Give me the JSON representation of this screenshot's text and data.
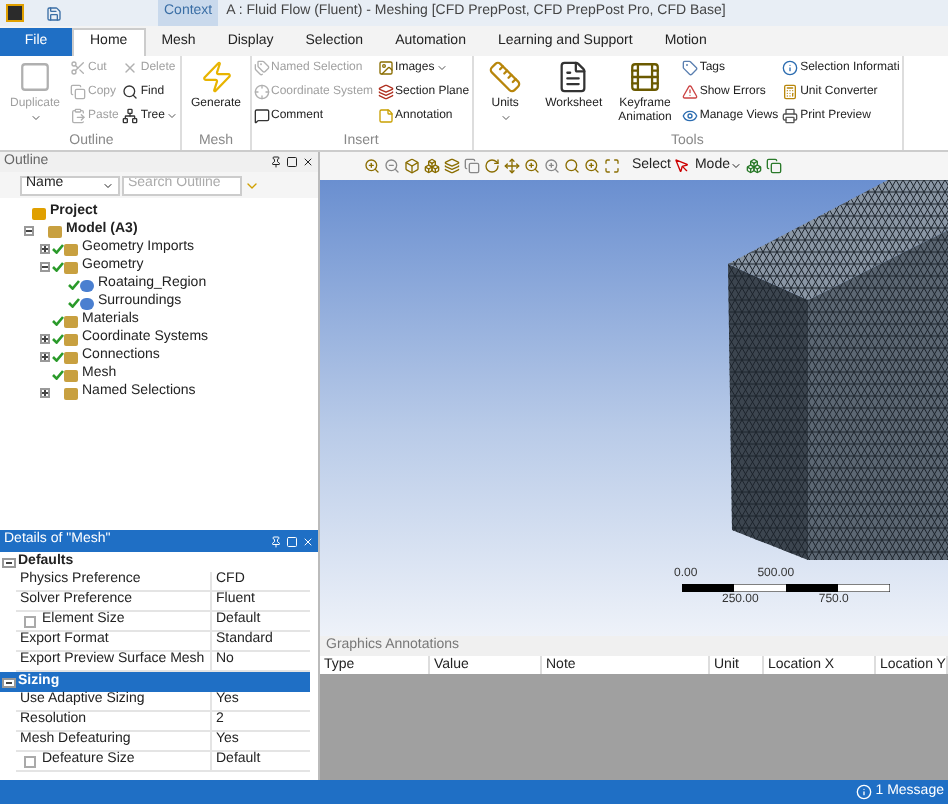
{
  "title_bar": {
    "context_tab": "Context",
    "title": "A : Fluid Flow (Fluent) - Meshing [CFD PrepPost, CFD PrepPost Pro, CFD Base]"
  },
  "ribbon_tabs": [
    {
      "label": "File",
      "kind": "file",
      "selected": false
    },
    {
      "label": "Home",
      "kind": "tab",
      "selected": true
    },
    {
      "label": "Mesh",
      "kind": "tab",
      "selected": false
    },
    {
      "label": "Display",
      "kind": "tab",
      "selected": false
    },
    {
      "label": "Selection",
      "kind": "tab",
      "selected": false
    },
    {
      "label": "Automation",
      "kind": "tab",
      "selected": false
    },
    {
      "label": "Learning and Support",
      "kind": "tab",
      "selected": false
    },
    {
      "label": "Motion",
      "kind": "tab",
      "selected": false
    }
  ],
  "ribbon_groups": [
    {
      "label": "Outline",
      "columns": [
        [
          {
            "label": "Duplicate",
            "kind": "large",
            "disabled": true,
            "dropdown": true
          }
        ],
        [
          {
            "label": "Cut",
            "kind": "small",
            "disabled": true,
            "dropdown": false
          },
          {
            "label": "Copy",
            "kind": "small",
            "disabled": true,
            "dropdown": false
          },
          {
            "label": "Paste",
            "kind": "small",
            "disabled": true,
            "dropdown": false
          }
        ],
        [
          {
            "label": "Delete",
            "kind": "small",
            "disabled": true,
            "dropdown": false
          },
          {
            "label": "Find",
            "kind": "small",
            "disabled": false,
            "dropdown": false
          },
          {
            "label": "Tree",
            "kind": "small",
            "disabled": false,
            "dropdown": true
          }
        ]
      ]
    },
    {
      "label": "Mesh",
      "columns": [
        [
          {
            "label": "Generate",
            "kind": "large",
            "disabled": false,
            "dropdown": false
          }
        ]
      ]
    },
    {
      "label": "Insert",
      "columns": [
        [
          {
            "label": "Named Selection",
            "kind": "small",
            "disabled": true,
            "dropdown": false
          },
          {
            "label": "Coordinate System",
            "kind": "small",
            "disabled": true,
            "dropdown": false
          },
          {
            "label": "Comment",
            "kind": "small",
            "disabled": false,
            "dropdown": false
          }
        ],
        [
          {
            "label": "Images",
            "kind": "small",
            "disabled": false,
            "dropdown": true
          },
          {
            "label": "Section Plane",
            "kind": "small",
            "disabled": false,
            "dropdown": false
          },
          {
            "label": "Annotation",
            "kind": "small",
            "disabled": false,
            "dropdown": false
          }
        ]
      ]
    },
    {
      "label": "Tools",
      "columns": [
        [
          {
            "label": "Units",
            "kind": "large",
            "disabled": false,
            "dropdown": true
          }
        ],
        [
          {
            "label": "Worksheet",
            "kind": "large",
            "disabled": false,
            "dropdown": false
          }
        ],
        [
          {
            "label": "Keyframe Animation",
            "kind": "large",
            "disabled": false,
            "dropdown": false
          }
        ],
        [
          {
            "label": "Tags",
            "kind": "small",
            "disabled": false,
            "dropdown": false
          },
          {
            "label": "Show Errors",
            "kind": "small",
            "disabled": false,
            "dropdown": false
          },
          {
            "label": "Manage Views",
            "kind": "small",
            "disabled": false,
            "dropdown": false
          }
        ],
        [
          {
            "label": "Selection Informati",
            "kind": "small",
            "disabled": false,
            "dropdown": false
          },
          {
            "label": "Unit Converter",
            "kind": "small",
            "disabled": false,
            "dropdown": false
          },
          {
            "label": "Print Preview",
            "kind": "small",
            "disabled": false,
            "dropdown": false
          }
        ]
      ]
    }
  ],
  "outline": {
    "title": "Outline",
    "filter": "Name",
    "search_placeholder": "Search Outline",
    "tree": [
      {
        "label": "Project",
        "ok": false,
        "children": [
          {
            "label": "Model (A3)",
            "ok": false,
            "expanded": true,
            "children": [
              {
                "label": "Geometry Imports",
                "ok": true,
                "expanded": false
              },
              {
                "label": "Geometry",
                "ok": true,
                "expanded": true,
                "children": [
                  {
                    "label": "Roataing_Region",
                    "ok": true
                  },
                  {
                    "label": "Surroundings",
                    "ok": true
                  }
                ]
              },
              {
                "label": "Materials",
                "ok": true
              },
              {
                "label": "Coordinate Systems",
                "ok": true,
                "expanded": false
              },
              {
                "label": "Connections",
                "ok": true,
                "expanded": false
              },
              {
                "label": "Mesh",
                "ok": true
              },
              {
                "label": "Named Selections",
                "ok": false,
                "expanded": false
              }
            ]
          }
        ]
      }
    ]
  },
  "details": {
    "title": "Details of \"Mesh\"",
    "sections": [
      {
        "label": "Defaults",
        "selected": false,
        "expanded": true,
        "rows": [
          {
            "name": "Physics Preference",
            "value": "CFD",
            "kind": "plain"
          },
          {
            "name": "Solver Preference",
            "value": "Fluent",
            "kind": "plain"
          },
          {
            "name": "Element Size",
            "value": "Default",
            "kind": "checkbox",
            "checked": false
          },
          {
            "name": "Export Format",
            "value": "Standard",
            "kind": "plain"
          },
          {
            "name": "Export Preview Surface Mesh",
            "value": "No",
            "kind": "plain"
          }
        ]
      },
      {
        "label": "Sizing",
        "selected": true,
        "expanded": true,
        "rows": [
          {
            "name": "Use Adaptive Sizing",
            "value": "Yes",
            "kind": "plain"
          },
          {
            "name": "Resolution",
            "value": "2",
            "kind": "plain"
          },
          {
            "name": "Mesh Defeaturing",
            "value": "Yes",
            "kind": "plain"
          },
          {
            "name": "Defeature Size",
            "value": "Default",
            "kind": "checkbox",
            "checked": false
          }
        ]
      }
    ]
  },
  "graphics_toolbar": {
    "select_label": "Select",
    "mode_label": "Mode"
  },
  "scale_bar": {
    "top_labels": [
      "0.00",
      "500.00"
    ],
    "bottom_labels": [
      "250.00",
      "750.0"
    ]
  },
  "annotations": {
    "title": "Graphics Annotations",
    "columns": [
      "Type",
      "Value",
      "Note",
      "Unit",
      "Location X",
      "Location Y"
    ]
  },
  "status_bar": {
    "messages": "1 Message"
  }
}
